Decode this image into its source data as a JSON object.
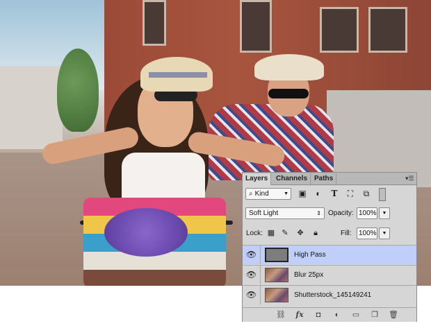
{
  "panel": {
    "tabs": [
      {
        "label": "Layers",
        "active": true
      },
      {
        "label": "Channels",
        "active": false
      },
      {
        "label": "Paths",
        "active": false
      }
    ],
    "menu_icon": "panel-menu-icon",
    "filter": {
      "kind_label": "Kind",
      "icons": [
        "pixel-filter-icon",
        "adjustment-filter-icon",
        "type-filter-icon",
        "shape-filter-icon",
        "smart-object-filter-icon"
      ]
    },
    "blend_mode": "Soft Light",
    "opacity_label": "Opacity:",
    "opacity_value": "100%",
    "lock_label": "Lock:",
    "lock_icons": [
      "lock-transparent-icon",
      "lock-image-icon",
      "lock-position-icon",
      "lock-all-icon"
    ],
    "fill_label": "Fill:",
    "fill_value": "100%",
    "layers": [
      {
        "name": "High Pass",
        "visible": true,
        "selected": true,
        "thumbnail": "gray"
      },
      {
        "name": "Blur 25px",
        "visible": true,
        "selected": false,
        "thumbnail": "photo"
      },
      {
        "name": "Shutterstock_145149241",
        "visible": true,
        "selected": false,
        "thumbnail": "photo"
      }
    ],
    "footer_icons": [
      "link-layers-icon",
      "fx-icon",
      "add-mask-icon",
      "adjustment-layer-icon",
      "new-group-icon",
      "new-layer-icon",
      "trash-icon"
    ],
    "footer_fx_label": "fx"
  },
  "colors": {
    "panel_bg": "#d6d6d6",
    "selected_layer": "#c0cffa",
    "tab_bar": "#b8b8b8"
  }
}
